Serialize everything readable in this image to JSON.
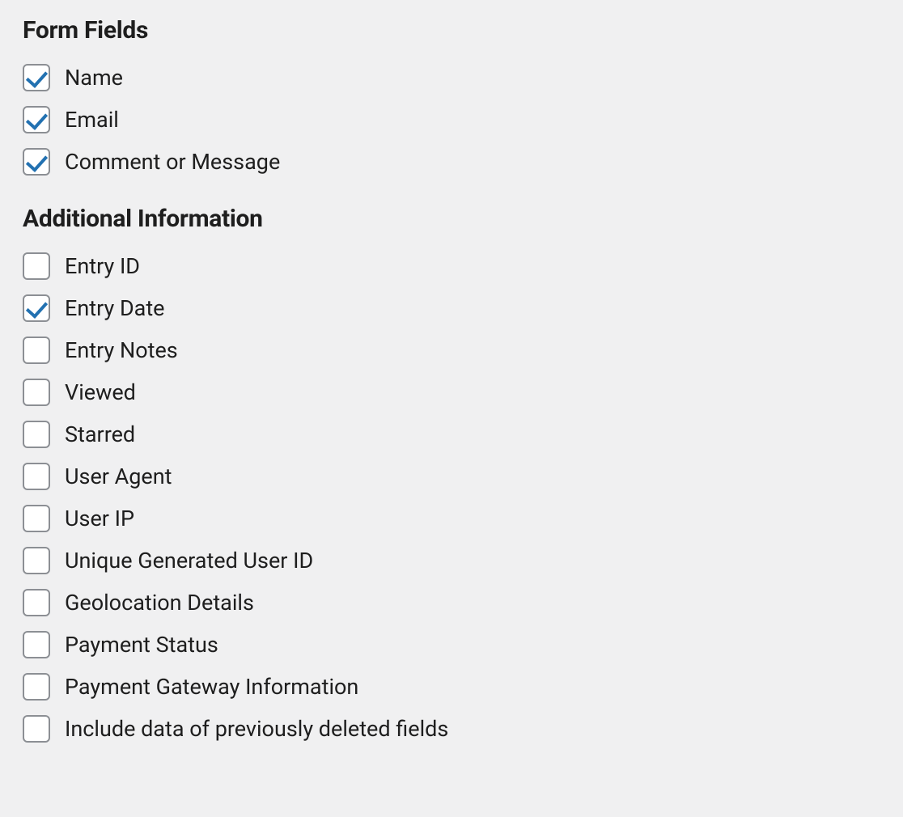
{
  "sections": [
    {
      "heading": "Form Fields",
      "key": "form_fields",
      "items": [
        {
          "label": "Name",
          "checked": true,
          "key": "name"
        },
        {
          "label": "Email",
          "checked": true,
          "key": "email"
        },
        {
          "label": "Comment or Message",
          "checked": true,
          "key": "comment-or-message"
        }
      ]
    },
    {
      "heading": "Additional Information",
      "key": "additional_information",
      "items": [
        {
          "label": "Entry ID",
          "checked": false,
          "key": "entry-id"
        },
        {
          "label": "Entry Date",
          "checked": true,
          "key": "entry-date"
        },
        {
          "label": "Entry Notes",
          "checked": false,
          "key": "entry-notes"
        },
        {
          "label": "Viewed",
          "checked": false,
          "key": "viewed"
        },
        {
          "label": "Starred",
          "checked": false,
          "key": "starred"
        },
        {
          "label": "User Agent",
          "checked": false,
          "key": "user-agent"
        },
        {
          "label": "User IP",
          "checked": false,
          "key": "user-ip"
        },
        {
          "label": "Unique Generated User ID",
          "checked": false,
          "key": "unique-generated-user-id"
        },
        {
          "label": "Geolocation Details",
          "checked": false,
          "key": "geolocation-details"
        },
        {
          "label": "Payment Status",
          "checked": false,
          "key": "payment-status"
        },
        {
          "label": "Payment Gateway Information",
          "checked": false,
          "key": "payment-gateway-information"
        },
        {
          "label": "Include data of previously deleted fields",
          "checked": false,
          "key": "include-deleted-fields"
        }
      ]
    }
  ]
}
